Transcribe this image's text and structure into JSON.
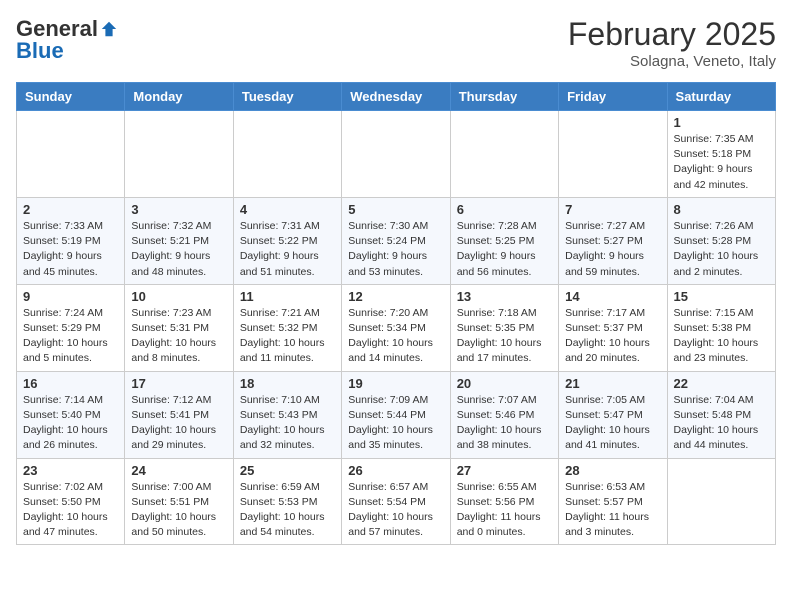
{
  "logo": {
    "general": "General",
    "blue": "Blue"
  },
  "title": {
    "month": "February 2025",
    "location": "Solagna, Veneto, Italy"
  },
  "days_of_week": [
    "Sunday",
    "Monday",
    "Tuesday",
    "Wednesday",
    "Thursday",
    "Friday",
    "Saturday"
  ],
  "weeks": [
    [
      {
        "num": "",
        "info": ""
      },
      {
        "num": "",
        "info": ""
      },
      {
        "num": "",
        "info": ""
      },
      {
        "num": "",
        "info": ""
      },
      {
        "num": "",
        "info": ""
      },
      {
        "num": "",
        "info": ""
      },
      {
        "num": "1",
        "info": "Sunrise: 7:35 AM\nSunset: 5:18 PM\nDaylight: 9 hours and 42 minutes."
      }
    ],
    [
      {
        "num": "2",
        "info": "Sunrise: 7:33 AM\nSunset: 5:19 PM\nDaylight: 9 hours and 45 minutes."
      },
      {
        "num": "3",
        "info": "Sunrise: 7:32 AM\nSunset: 5:21 PM\nDaylight: 9 hours and 48 minutes."
      },
      {
        "num": "4",
        "info": "Sunrise: 7:31 AM\nSunset: 5:22 PM\nDaylight: 9 hours and 51 minutes."
      },
      {
        "num": "5",
        "info": "Sunrise: 7:30 AM\nSunset: 5:24 PM\nDaylight: 9 hours and 53 minutes."
      },
      {
        "num": "6",
        "info": "Sunrise: 7:28 AM\nSunset: 5:25 PM\nDaylight: 9 hours and 56 minutes."
      },
      {
        "num": "7",
        "info": "Sunrise: 7:27 AM\nSunset: 5:27 PM\nDaylight: 9 hours and 59 minutes."
      },
      {
        "num": "8",
        "info": "Sunrise: 7:26 AM\nSunset: 5:28 PM\nDaylight: 10 hours and 2 minutes."
      }
    ],
    [
      {
        "num": "9",
        "info": "Sunrise: 7:24 AM\nSunset: 5:29 PM\nDaylight: 10 hours and 5 minutes."
      },
      {
        "num": "10",
        "info": "Sunrise: 7:23 AM\nSunset: 5:31 PM\nDaylight: 10 hours and 8 minutes."
      },
      {
        "num": "11",
        "info": "Sunrise: 7:21 AM\nSunset: 5:32 PM\nDaylight: 10 hours and 11 minutes."
      },
      {
        "num": "12",
        "info": "Sunrise: 7:20 AM\nSunset: 5:34 PM\nDaylight: 10 hours and 14 minutes."
      },
      {
        "num": "13",
        "info": "Sunrise: 7:18 AM\nSunset: 5:35 PM\nDaylight: 10 hours and 17 minutes."
      },
      {
        "num": "14",
        "info": "Sunrise: 7:17 AM\nSunset: 5:37 PM\nDaylight: 10 hours and 20 minutes."
      },
      {
        "num": "15",
        "info": "Sunrise: 7:15 AM\nSunset: 5:38 PM\nDaylight: 10 hours and 23 minutes."
      }
    ],
    [
      {
        "num": "16",
        "info": "Sunrise: 7:14 AM\nSunset: 5:40 PM\nDaylight: 10 hours and 26 minutes."
      },
      {
        "num": "17",
        "info": "Sunrise: 7:12 AM\nSunset: 5:41 PM\nDaylight: 10 hours and 29 minutes."
      },
      {
        "num": "18",
        "info": "Sunrise: 7:10 AM\nSunset: 5:43 PM\nDaylight: 10 hours and 32 minutes."
      },
      {
        "num": "19",
        "info": "Sunrise: 7:09 AM\nSunset: 5:44 PM\nDaylight: 10 hours and 35 minutes."
      },
      {
        "num": "20",
        "info": "Sunrise: 7:07 AM\nSunset: 5:46 PM\nDaylight: 10 hours and 38 minutes."
      },
      {
        "num": "21",
        "info": "Sunrise: 7:05 AM\nSunset: 5:47 PM\nDaylight: 10 hours and 41 minutes."
      },
      {
        "num": "22",
        "info": "Sunrise: 7:04 AM\nSunset: 5:48 PM\nDaylight: 10 hours and 44 minutes."
      }
    ],
    [
      {
        "num": "23",
        "info": "Sunrise: 7:02 AM\nSunset: 5:50 PM\nDaylight: 10 hours and 47 minutes."
      },
      {
        "num": "24",
        "info": "Sunrise: 7:00 AM\nSunset: 5:51 PM\nDaylight: 10 hours and 50 minutes."
      },
      {
        "num": "25",
        "info": "Sunrise: 6:59 AM\nSunset: 5:53 PM\nDaylight: 10 hours and 54 minutes."
      },
      {
        "num": "26",
        "info": "Sunrise: 6:57 AM\nSunset: 5:54 PM\nDaylight: 10 hours and 57 minutes."
      },
      {
        "num": "27",
        "info": "Sunrise: 6:55 AM\nSunset: 5:56 PM\nDaylight: 11 hours and 0 minutes."
      },
      {
        "num": "28",
        "info": "Sunrise: 6:53 AM\nSunset: 5:57 PM\nDaylight: 11 hours and 3 minutes."
      },
      {
        "num": "",
        "info": ""
      }
    ]
  ]
}
